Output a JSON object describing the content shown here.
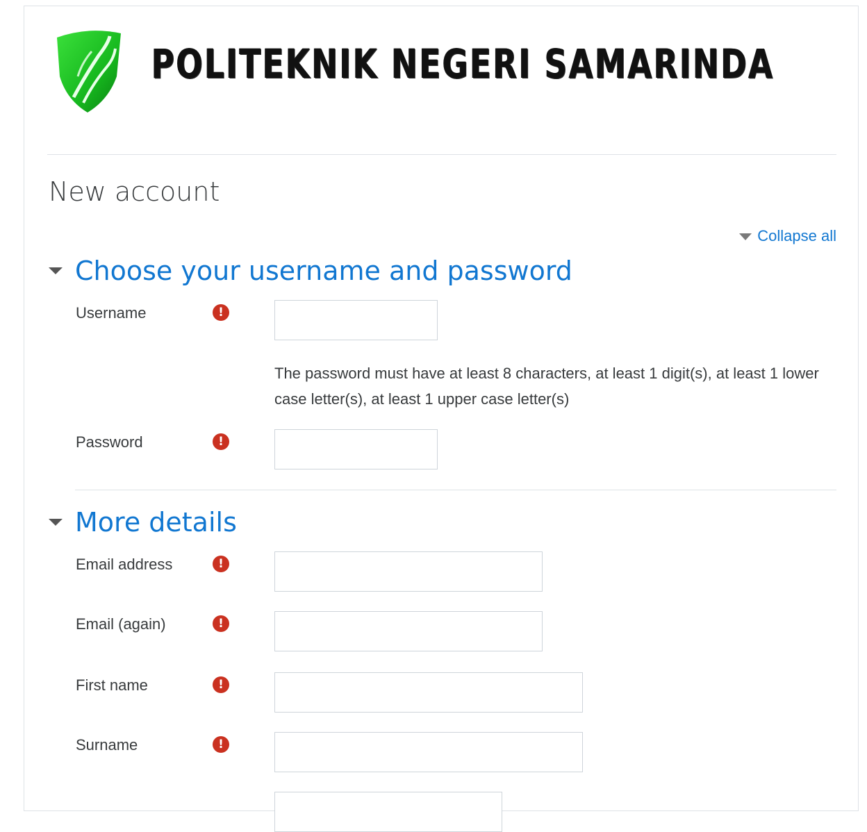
{
  "brand": {
    "logo_text": "POLITEKNIK NEGERI SAMARINDA"
  },
  "page": {
    "title": "New account",
    "collapse_all_label": "Collapse all"
  },
  "sections": [
    {
      "title": "Choose your username and password",
      "fields": [
        {
          "label": "Username",
          "value": ""
        },
        {
          "label": "Password",
          "value": ""
        }
      ],
      "password_help": "The password must have at least 8 characters, at least 1 digit(s), at least 1 lower case letter(s), at least 1 upper case letter(s)"
    },
    {
      "title": "More details",
      "fields": [
        {
          "label": "Email address",
          "value": ""
        },
        {
          "label": "Email (again)",
          "value": ""
        },
        {
          "label": "First name",
          "value": ""
        },
        {
          "label": "Surname",
          "value": ""
        }
      ]
    }
  ],
  "required_icon": "exclamation-circle-icon",
  "colors": {
    "link": "#1177d1",
    "required": "#ca3120",
    "text": "#373a3c"
  }
}
